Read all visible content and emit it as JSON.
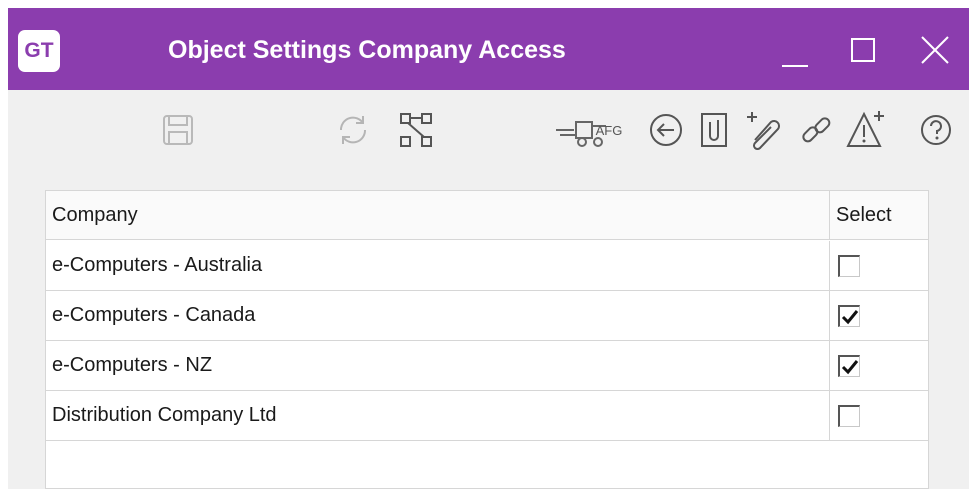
{
  "window": {
    "logo_text": "GT",
    "title": "Object Settings Company Access",
    "title_color": "#8b3dae"
  },
  "toolbar": {
    "afg_label": "AFG",
    "icons": [
      "save-icon",
      "refresh-icon",
      "hierarchy-icon",
      "fork-lift-icon",
      "back-arrow-icon",
      "attachment-icon",
      "add-attachment-icon",
      "link-icon",
      "add-alert-icon",
      "help-icon"
    ]
  },
  "table": {
    "columns": [
      "Company",
      "Select"
    ],
    "rows": [
      {
        "company": "e-Computers - Australia",
        "selected": false
      },
      {
        "company": "e-Computers - Canada",
        "selected": true
      },
      {
        "company": "e-Computers - NZ",
        "selected": true
      },
      {
        "company": "Distribution Company Ltd",
        "selected": false
      }
    ]
  }
}
